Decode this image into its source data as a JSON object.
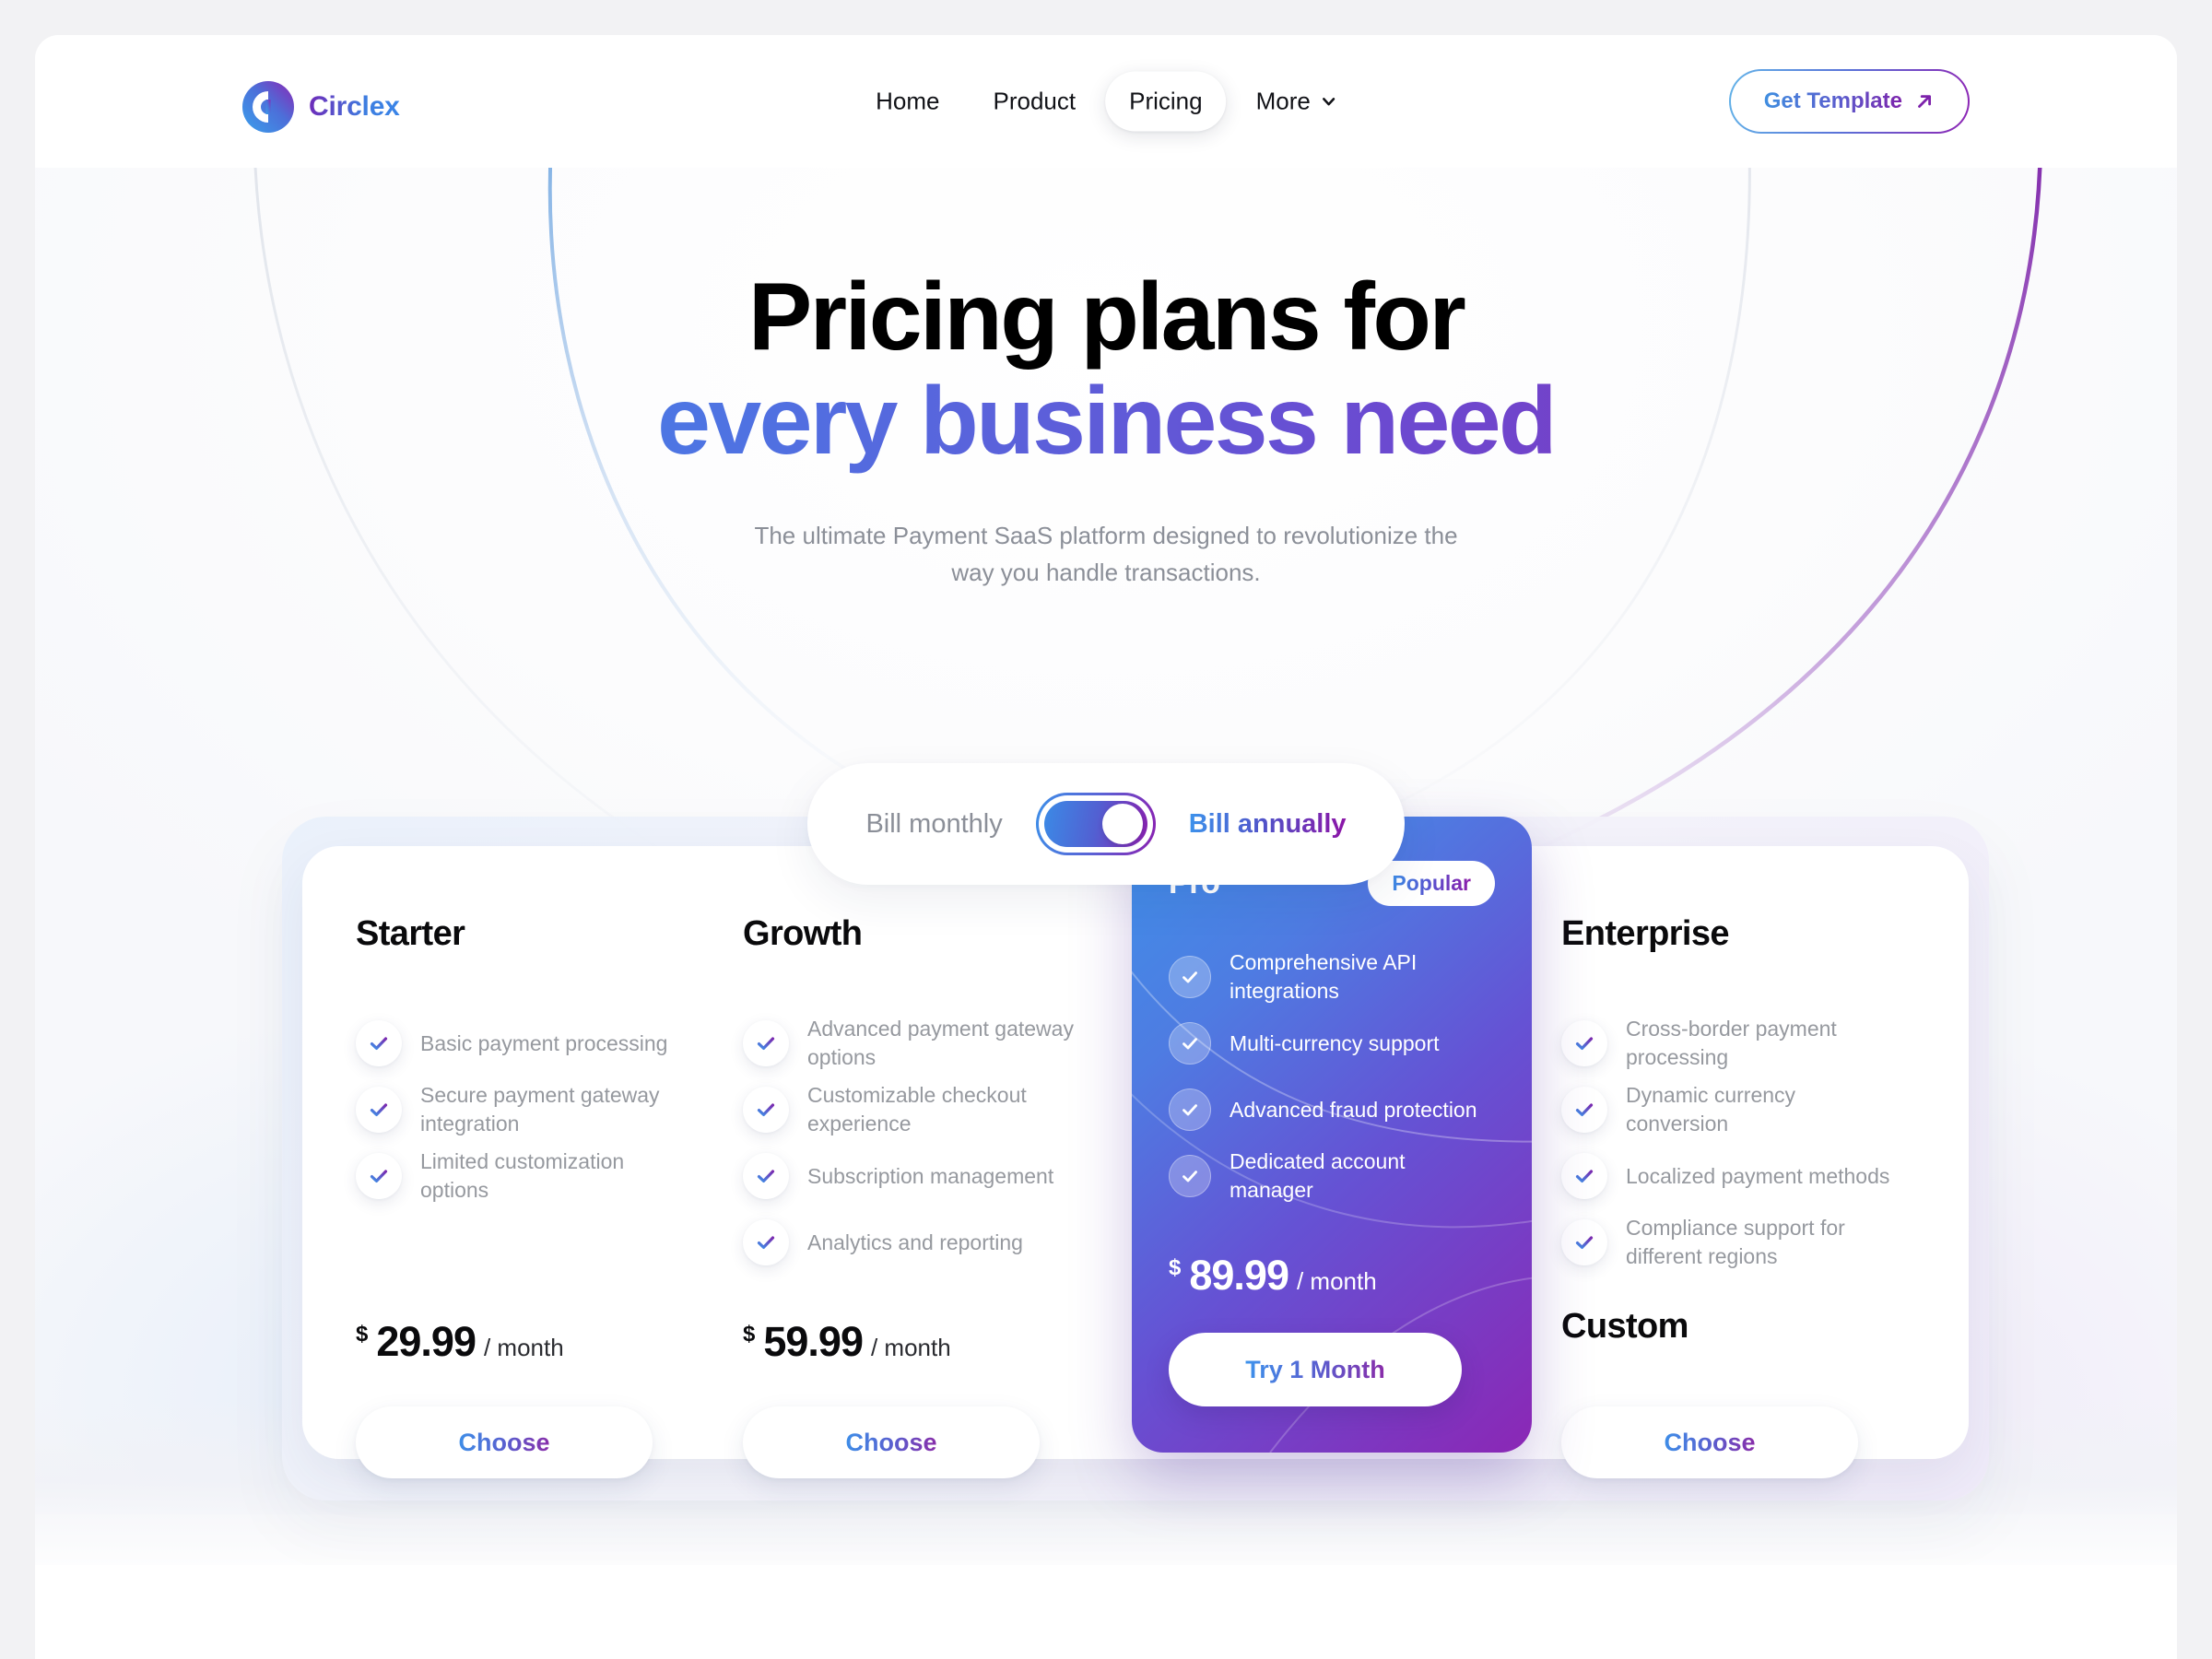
{
  "brand": {
    "name": "Circlex",
    "logo_icon": "circlex-logo-icon"
  },
  "nav": {
    "items": [
      {
        "label": "Home",
        "active": false
      },
      {
        "label": "Product",
        "active": false
      },
      {
        "label": "Pricing",
        "active": true
      },
      {
        "label": "More",
        "active": false,
        "icon": "chevron-down-icon"
      }
    ],
    "cta": {
      "label": "Get Template",
      "icon": "arrow-up-right-icon"
    }
  },
  "hero": {
    "title_line1": "Pricing plans for",
    "title_line2": "every business need",
    "subtitle": "The ultimate Payment SaaS platform designed to revolutionize the way you handle transactions."
  },
  "billing": {
    "monthly_label": "Bill monthly",
    "annually_label": "Bill annually",
    "selected": "annually",
    "toggle_state": "on"
  },
  "plans": [
    {
      "name": "Starter",
      "features": [
        "Basic payment processing",
        "Secure payment gateway integration",
        "Limited customization options"
      ],
      "currency": "$",
      "price": "29.99",
      "period": "/ month",
      "button": "Choose",
      "featured": false
    },
    {
      "name": "Growth",
      "features": [
        "Advanced payment gateway options",
        "Customizable checkout experience",
        "Subscription management",
        "Analytics and reporting"
      ],
      "currency": "$",
      "price": "59.99",
      "period": "/ month",
      "button": "Choose",
      "featured": false
    },
    {
      "name": "Pro",
      "badge": "Popular",
      "features": [
        "Comprehensive API integrations",
        "Multi-currency support",
        "Advanced fraud protection",
        "Dedicated account manager"
      ],
      "currency": "$",
      "price": "89.99",
      "period": "/ month",
      "button": "Try 1 Month",
      "featured": true
    },
    {
      "name": "Enterprise",
      "features": [
        "Cross-border payment processing",
        "Dynamic currency conversion",
        "Localized payment methods",
        "Compliance support for different regions"
      ],
      "price_custom": "Custom",
      "button": "Choose",
      "featured": false
    }
  ],
  "colors": {
    "accent_blue": "#3d8fe8",
    "accent_purple": "#8b27b5",
    "text_primary": "#0a0a0c",
    "text_muted": "#96999f",
    "page_bg": "#f2f2f4"
  }
}
